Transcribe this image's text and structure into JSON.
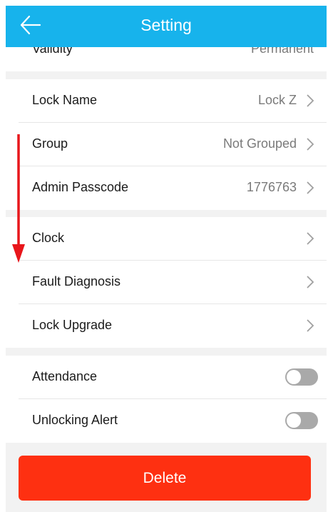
{
  "header": {
    "title": "Setting",
    "back_icon": "back-arrow-icon",
    "background_color": "#17b3ec"
  },
  "partial_row": {
    "label": "Validity",
    "value": "Permanent"
  },
  "group1": [
    {
      "label": "Lock Name",
      "value": "Lock Z"
    },
    {
      "label": "Group",
      "value": "Not Grouped"
    },
    {
      "label": "Admin Passcode",
      "value": "1776763"
    }
  ],
  "group2": [
    {
      "label": "Clock"
    },
    {
      "label": "Fault Diagnosis"
    },
    {
      "label": "Lock Upgrade"
    }
  ],
  "group3": [
    {
      "label": "Attendance",
      "enabled": false
    },
    {
      "label": "Unlocking Alert",
      "enabled": false
    }
  ],
  "delete_button": {
    "label": "Delete",
    "color": "#fe3011"
  },
  "annotation": {
    "arrow_color": "#e8161b",
    "direction": "down"
  }
}
